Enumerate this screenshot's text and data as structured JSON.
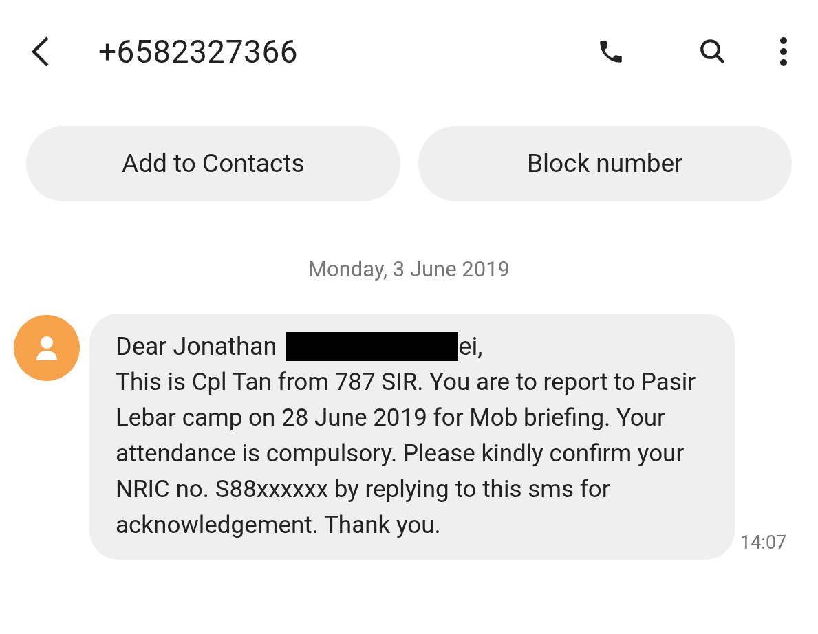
{
  "header": {
    "title": "+6582327366"
  },
  "actions": [
    "Add to Contacts",
    "Block number"
  ],
  "date": "Monday, 3 June 2019",
  "message": {
    "greeting_start": "Dear Jonathan",
    "greeting_end": "ei,",
    "body": "This is Cpl Tan from 787 SIR. You are to report to Pasir Lebar camp on 28 June 2019 for Mob briefing. Your attendance is compulsory. Please kindly confirm your NRIC no. S88xxxxxx by replying to this sms for acknowledgement. Thank you.",
    "time": "14:07"
  }
}
